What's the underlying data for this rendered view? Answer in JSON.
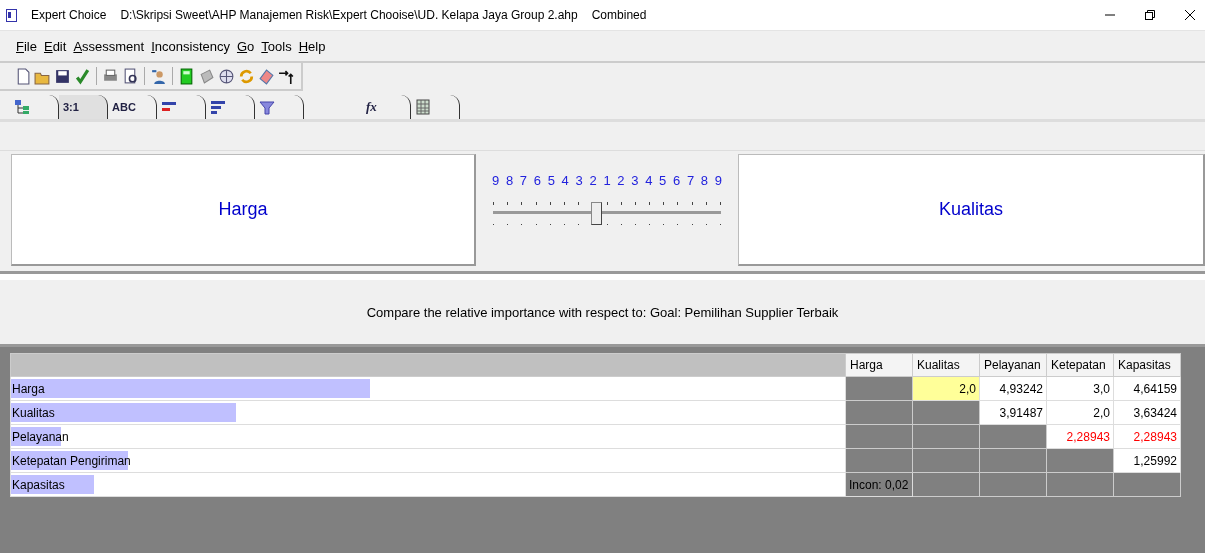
{
  "window": {
    "app": "Expert Choice",
    "path": "D:\\Skripsi Sweet\\AHP Manajemen Risk\\Expert Chooise\\UD. Kelapa Jaya Group 2.ahp",
    "mode": "Combined"
  },
  "menu": [
    "File",
    "Edit",
    "Assessment",
    "Inconsistency",
    "Go",
    "Tools",
    "Help"
  ],
  "toolbar": [
    {
      "kind": "new"
    },
    {
      "kind": "open"
    },
    {
      "kind": "save"
    },
    {
      "kind": "check"
    },
    {
      "kind": "sep"
    },
    {
      "kind": "print"
    },
    {
      "kind": "preview"
    },
    {
      "kind": "sep"
    },
    {
      "kind": "person"
    },
    {
      "kind": "sep"
    },
    {
      "kind": "calc"
    },
    {
      "kind": "grey"
    },
    {
      "kind": "globe"
    },
    {
      "kind": "refresh"
    },
    {
      "kind": "eraser"
    },
    {
      "kind": "arrows"
    }
  ],
  "tabs": [
    {
      "kind": "tree",
      "selected": false
    },
    {
      "kind": "text",
      "label": "3:1",
      "selected": true
    },
    {
      "kind": "text",
      "label": "ABC",
      "selected": false
    },
    {
      "kind": "bars",
      "selected": false
    },
    {
      "kind": "lines",
      "selected": false
    },
    {
      "kind": "funnel",
      "selected": false
    },
    {
      "kind": "text",
      "label": "fx",
      "selected": false
    },
    {
      "kind": "grid",
      "selected": false
    }
  ],
  "comparison": {
    "left": "Harga",
    "right": "Kualitas",
    "scale": [
      "9",
      "8",
      "7",
      "6",
      "5",
      "4",
      "3",
      "2",
      "1",
      "2",
      "3",
      "4",
      "5",
      "6",
      "7",
      "8",
      "9"
    ],
    "level": 0.45
  },
  "prompt": "Compare the relative importance with respect to: Goal: Pemilihan Supplier Terbaik",
  "matrix": {
    "columns": [
      "Harga",
      "Kualitas",
      "Pelayanan",
      "Ketepatan",
      "Kapasitas"
    ],
    "rows": [
      {
        "label": "Harga",
        "level": 0.43,
        "cells": [
          {
            "kind": "blank"
          },
          {
            "kind": "value",
            "text": "2,0",
            "selected": true,
            "inverted": false
          },
          {
            "kind": "value",
            "text": "4,93242",
            "selected": false,
            "inverted": false
          },
          {
            "kind": "value",
            "text": "3,0",
            "selected": false,
            "inverted": false
          },
          {
            "kind": "value",
            "text": "4,64159",
            "selected": false,
            "inverted": false
          }
        ]
      },
      {
        "label": "Kualitas",
        "level": 0.27,
        "cells": [
          {
            "kind": "blank"
          },
          {
            "kind": "blank"
          },
          {
            "kind": "value",
            "text": "3,91487",
            "selected": false,
            "inverted": false
          },
          {
            "kind": "value",
            "text": "2,0",
            "selected": false,
            "inverted": false
          },
          {
            "kind": "value",
            "text": "3,63424",
            "selected": false,
            "inverted": false
          }
        ]
      },
      {
        "label": "Pelayanan",
        "level": 0.06,
        "cells": [
          {
            "kind": "blank"
          },
          {
            "kind": "blank"
          },
          {
            "kind": "blank"
          },
          {
            "kind": "value",
            "text": "2,28943",
            "selected": false,
            "inverted": true
          },
          {
            "kind": "value",
            "text": "2,28943",
            "selected": false,
            "inverted": true
          }
        ]
      },
      {
        "label": "Ketepatan Pengiriman",
        "level": 0.14,
        "cells": [
          {
            "kind": "blank"
          },
          {
            "kind": "blank"
          },
          {
            "kind": "blank"
          },
          {
            "kind": "blank"
          },
          {
            "kind": "value",
            "text": "1,25992",
            "selected": false,
            "inverted": false
          }
        ]
      },
      {
        "label": "Kapasitas",
        "level": 0.1,
        "cells": [
          {
            "kind": "note",
            "text": "Incon: 0,02"
          },
          {
            "kind": "blank"
          },
          {
            "kind": "blank"
          },
          {
            "kind": "blank"
          },
          {
            "kind": "blank"
          }
        ]
      }
    ]
  }
}
